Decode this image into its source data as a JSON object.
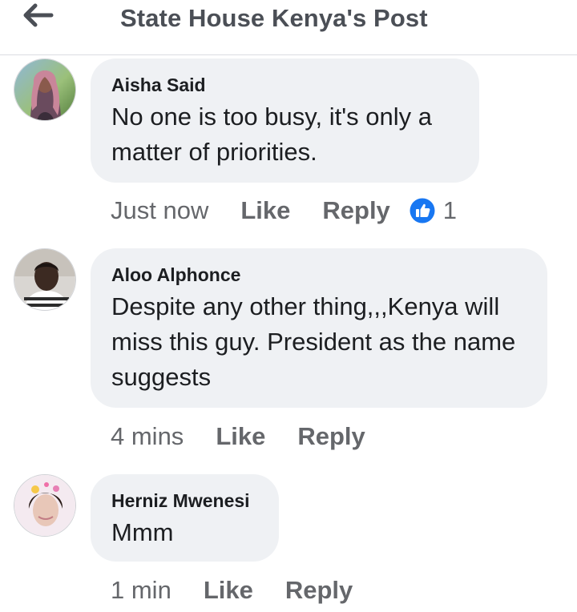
{
  "header": {
    "title": "State House Kenya's Post",
    "back_icon": "arrow-left-icon"
  },
  "comments": [
    {
      "author": "Aisha Said",
      "text": "No one is too busy, it's only a matter of priorities.",
      "time": "Just now",
      "like_label": "Like",
      "reply_label": "Reply",
      "reaction_icon": "like-icon",
      "reaction_count": "1"
    },
    {
      "author": "Aloo Alphonce",
      "text": "Despite any other thing,,,Kenya will miss this guy. President as the name suggests",
      "time": "4 mins",
      "like_label": "Like",
      "reply_label": "Reply"
    },
    {
      "author": "Herniz Mwenesi",
      "text": "Mmm",
      "time": "1 min",
      "like_label": "Like",
      "reply_label": "Reply"
    }
  ],
  "colors": {
    "bubble": "#eff1f4",
    "secondary_text": "#65676b",
    "like_blue": "#1877f2",
    "header_text": "#4b4f56"
  }
}
